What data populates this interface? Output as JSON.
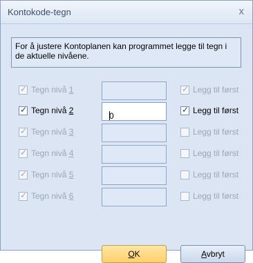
{
  "window": {
    "title": "Kontokode-tegn",
    "close_glyph": "x"
  },
  "info_text": "For å justere Kontoplanen kan programmet legge til tegn i de aktuelle nivåene.",
  "levels": [
    {
      "label_prefix": "Tegn nivå ",
      "number": "1",
      "level_checked": true,
      "enabled": false,
      "value": "",
      "legg_label": "Legg til først",
      "legg_checked": true,
      "legg_enabled": false
    },
    {
      "label_prefix": "Tegn nivå ",
      "number": "2",
      "level_checked": true,
      "enabled": true,
      "value": "0",
      "legg_label": "Legg til først",
      "legg_checked": true,
      "legg_enabled": true
    },
    {
      "label_prefix": "Tegn nivå ",
      "number": "3",
      "level_checked": true,
      "enabled": false,
      "value": "",
      "legg_label": "Legg til først",
      "legg_checked": false,
      "legg_enabled": false
    },
    {
      "label_prefix": "Tegn nivå ",
      "number": "4",
      "level_checked": true,
      "enabled": false,
      "value": "",
      "legg_label": "Legg til først",
      "legg_checked": false,
      "legg_enabled": false
    },
    {
      "label_prefix": "Tegn nivå ",
      "number": "5",
      "level_checked": true,
      "enabled": false,
      "value": "",
      "legg_label": "Legg til først",
      "legg_checked": false,
      "legg_enabled": false
    },
    {
      "label_prefix": "Tegn nivå ",
      "number": "6",
      "level_checked": true,
      "enabled": false,
      "value": "",
      "legg_label": "Legg til først",
      "legg_checked": false,
      "legg_enabled": false
    }
  ],
  "buttons": {
    "ok": {
      "mnemonic": "O",
      "rest": "K"
    },
    "cancel": {
      "mnemonic": "A",
      "rest": "vbryt"
    }
  }
}
